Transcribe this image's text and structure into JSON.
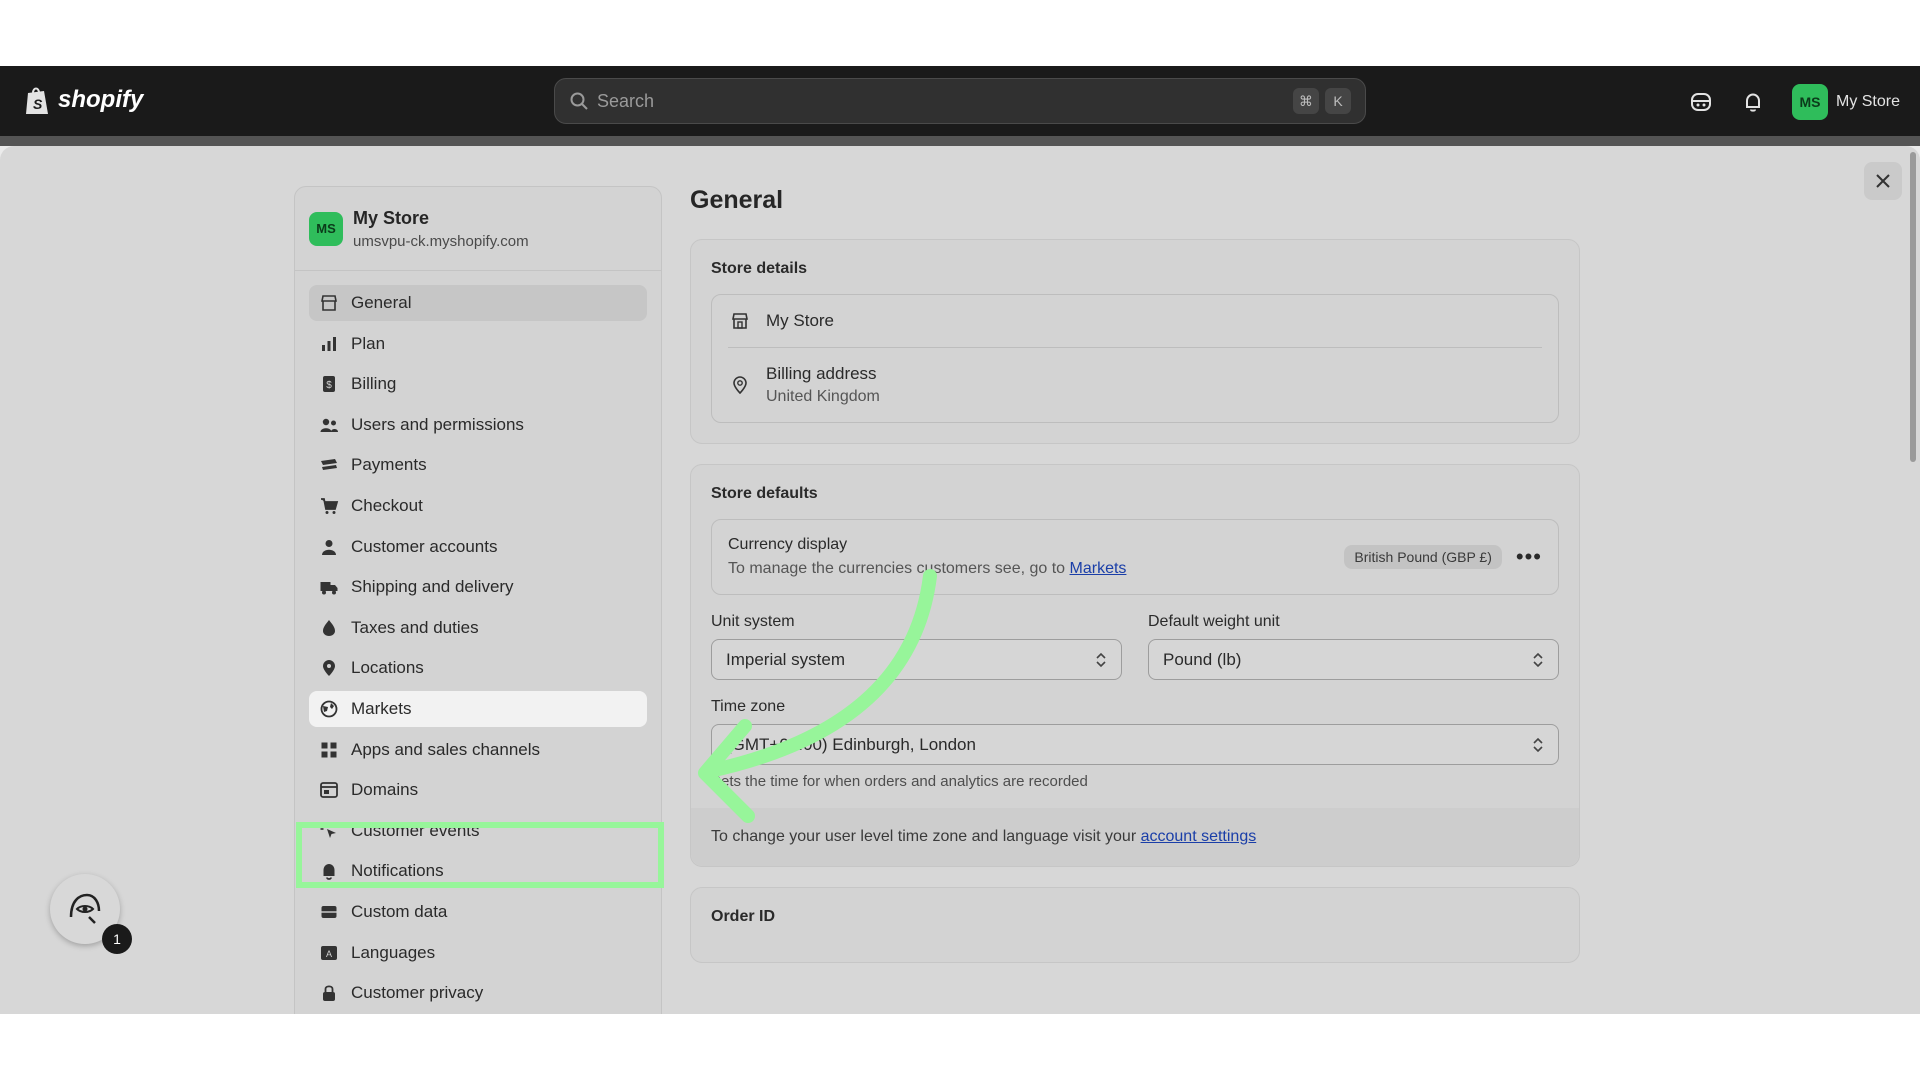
{
  "topbar": {
    "brand": "shopify",
    "search_placeholder": "Search",
    "shortcut_keys": [
      "⌘",
      "K"
    ],
    "store_initials": "MS",
    "store_name": "My Store"
  },
  "sidebar": {
    "store_initials": "MS",
    "store_name": "My Store",
    "store_url": "umsvpu-ck.myshopify.com",
    "items": [
      {
        "label": "General",
        "icon": "store-icon"
      },
      {
        "label": "Plan",
        "icon": "plan-icon"
      },
      {
        "label": "Billing",
        "icon": "billing-icon"
      },
      {
        "label": "Users and permissions",
        "icon": "users-icon"
      },
      {
        "label": "Payments",
        "icon": "payments-icon"
      },
      {
        "label": "Checkout",
        "icon": "cart-icon"
      },
      {
        "label": "Customer accounts",
        "icon": "person-icon"
      },
      {
        "label": "Shipping and delivery",
        "icon": "truck-icon"
      },
      {
        "label": "Taxes and duties",
        "icon": "tax-icon"
      },
      {
        "label": "Locations",
        "icon": "location-icon"
      },
      {
        "label": "Markets",
        "icon": "globe-icon"
      },
      {
        "label": "Apps and sales channels",
        "icon": "apps-icon"
      },
      {
        "label": "Domains",
        "icon": "domains-icon"
      },
      {
        "label": "Customer events",
        "icon": "cursor-icon"
      },
      {
        "label": "Notifications",
        "icon": "bell-icon"
      },
      {
        "label": "Custom data",
        "icon": "database-icon"
      },
      {
        "label": "Languages",
        "icon": "language-icon"
      },
      {
        "label": "Customer privacy",
        "icon": "lock-icon"
      }
    ]
  },
  "main": {
    "title": "General",
    "store_details": {
      "title": "Store details",
      "store_name": "My Store",
      "billing_label": "Billing address",
      "billing_value": "United Kingdom"
    },
    "store_defaults": {
      "title": "Store defaults",
      "currency_title": "Currency display",
      "currency_desc": "To manage the currencies customers see, go to",
      "currency_link": "Markets",
      "currency_badge": "British Pound (GBP £)",
      "unit_label": "Unit system",
      "unit_value": "Imperial system",
      "weight_label": "Default weight unit",
      "weight_value": "Pound (lb)",
      "tz_label": "Time zone",
      "tz_value": "(GMT+00:00) Edinburgh, London",
      "tz_hint": "Sets the time for when orders and analytics are recorded",
      "footer_text": "To change your user level time zone and language visit your",
      "footer_link": "account settings"
    },
    "order_id": {
      "title": "Order ID"
    }
  },
  "helper": {
    "badge_count": "1"
  },
  "colors": {
    "highlight": "#97f59a",
    "arrow": "#97f59a",
    "avatar": "#2fbd5b",
    "link": "#1a3ea8"
  }
}
